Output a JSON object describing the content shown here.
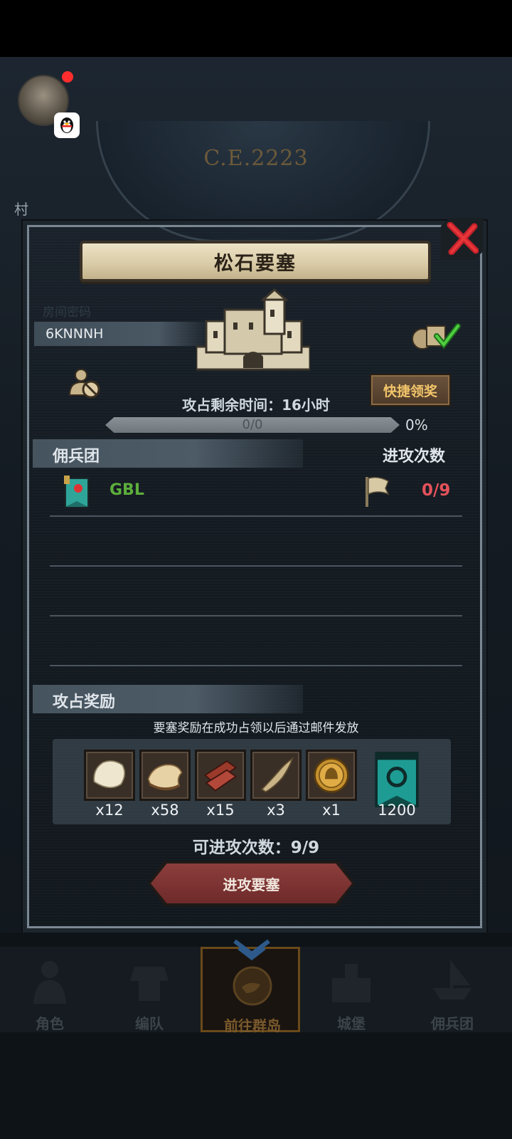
{
  "background": {
    "era_text": "C.E.2223",
    "village_label": "村"
  },
  "panel": {
    "title": "松石要塞",
    "room_code_label": "房间密码",
    "room_code": "6KNNNH",
    "quick_claim_label": "快捷领奖",
    "time_left_text": "攻占剩余时间：16小时",
    "progress": {
      "text": "0/0",
      "percent_text": "0%",
      "fraction": 0
    },
    "mercenary_section_title": "佣兵团",
    "attack_count_header": "进攻次数",
    "mercenaries": [
      {
        "name": "GBL",
        "attacks": "0/9"
      }
    ],
    "reward_section_title": "攻占奖励",
    "reward_note": "要塞奖励在成功占领以后通过邮件发放",
    "rewards": [
      {
        "icon": "hide-icon",
        "count": "x12"
      },
      {
        "icon": "leather-icon",
        "count": "x58"
      },
      {
        "icon": "wood-planks-icon",
        "count": "x15"
      },
      {
        "icon": "horn-icon",
        "count": "x3"
      },
      {
        "icon": "helmet-medal-icon",
        "count": "x1"
      },
      {
        "icon": "guild-banner-icon",
        "count": "1200"
      }
    ],
    "attempts_text": "可进攻次数：9/9",
    "attack_button_label": "进攻要塞"
  },
  "nav": {
    "items": [
      {
        "label": "角色",
        "icon": "knight-icon"
      },
      {
        "label": "编队",
        "icon": "armor-icon"
      },
      {
        "label": "前往群岛",
        "icon": "island-compass-icon",
        "active": true
      },
      {
        "label": "城堡",
        "icon": "castle-icon"
      },
      {
        "label": "佣兵团",
        "icon": "ship-icon"
      }
    ]
  },
  "colors": {
    "guild_name": "#5cae3b",
    "attack_count": "#e3525a",
    "quick_claim_text": "#f2c56a",
    "attack_button": "#7c3533"
  }
}
